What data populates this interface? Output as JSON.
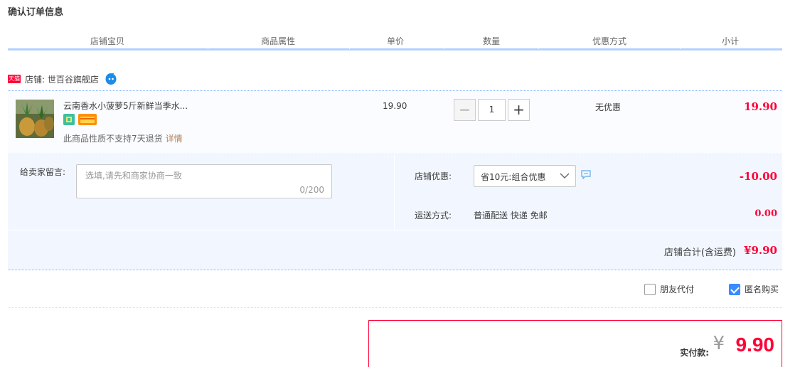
{
  "page": {
    "title": "确认订单信息"
  },
  "columns": [
    "店铺宝贝",
    "商品属性",
    "单价",
    "数量",
    "优惠方式",
    "小计"
  ],
  "shop": {
    "tmall_badge": "天猫",
    "label": "店铺: 世百谷旗舰店",
    "icons": [
      "tmall-icon",
      "wangwang-chat-icon"
    ]
  },
  "item": {
    "title": "云南香水小菠萝5斤新鲜当季水...",
    "note": "此商品性质不支持7天退货",
    "detail_link": "详情",
    "unit_price": "19.90",
    "quantity": "1",
    "minus": "−",
    "plus": "+",
    "discount_type": "无优惠",
    "subtotal": "19.90"
  },
  "message": {
    "label": "给卖家留言:",
    "placeholder": "选填,请先和商家协商一致",
    "count": "0/200"
  },
  "promotion": {
    "label": "店铺优惠:",
    "selected": "省10元:组合优惠",
    "amount": "-10.00"
  },
  "shipping": {
    "label": "运送方式:",
    "value": "普通配送 快递 免邮",
    "amount": "0.00"
  },
  "shop_total": {
    "label": "店铺合计(含运费)",
    "value": "¥9.90"
  },
  "options": {
    "friend_pay": {
      "label": "朋友代付",
      "checked": false
    },
    "anonymous": {
      "label": "匿名购买",
      "checked": true
    }
  },
  "payment": {
    "label": "实付款:",
    "currency": "¥",
    "amount": "9.90"
  },
  "colors": {
    "accent_red": "#ff0036",
    "header_line": "#b2d1ff",
    "row_bg": "#f2f7ff",
    "checkbox_blue": "#3a8bff"
  }
}
